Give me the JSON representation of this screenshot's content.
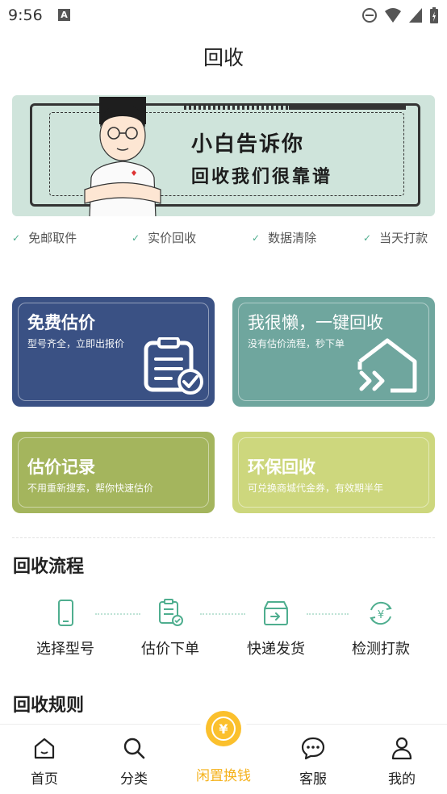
{
  "status_bar": {
    "time": "9:56",
    "notification_badge": "A"
  },
  "header": {
    "title": "回收"
  },
  "banner": {
    "line1": "小白告诉你",
    "line2": "回收我们很靠谱"
  },
  "features": [
    "免邮取件",
    "实价回收",
    "数据清除",
    "当天打款"
  ],
  "cards": {
    "estimate": {
      "title": "免费估价",
      "subtitle": "型号齐全，立即出报价"
    },
    "one_click": {
      "title": "我很懒，一键回收",
      "subtitle": "没有估价流程，秒下单"
    },
    "records": {
      "title": "估价记录",
      "subtitle": "不用重新搜索，帮你快速估价"
    },
    "eco": {
      "title": "环保回收",
      "subtitle": "可兑换商城代金券，有效期半年"
    }
  },
  "process": {
    "title": "回收流程",
    "steps": [
      "选择型号",
      "估价下单",
      "快递发货",
      "检测打款"
    ]
  },
  "rules": {
    "title": "回收规则"
  },
  "tabbar": {
    "items": [
      "首页",
      "分类",
      "闲置换钱",
      "客服",
      "我的"
    ]
  },
  "colors": {
    "accent_green": "#4fae8f",
    "card_blue": "#3a5184",
    "card_teal": "#6fa69e",
    "card_olive": "#a4b55d",
    "card_lime": "#cdd77d",
    "tab_active": "#f5b21c"
  }
}
